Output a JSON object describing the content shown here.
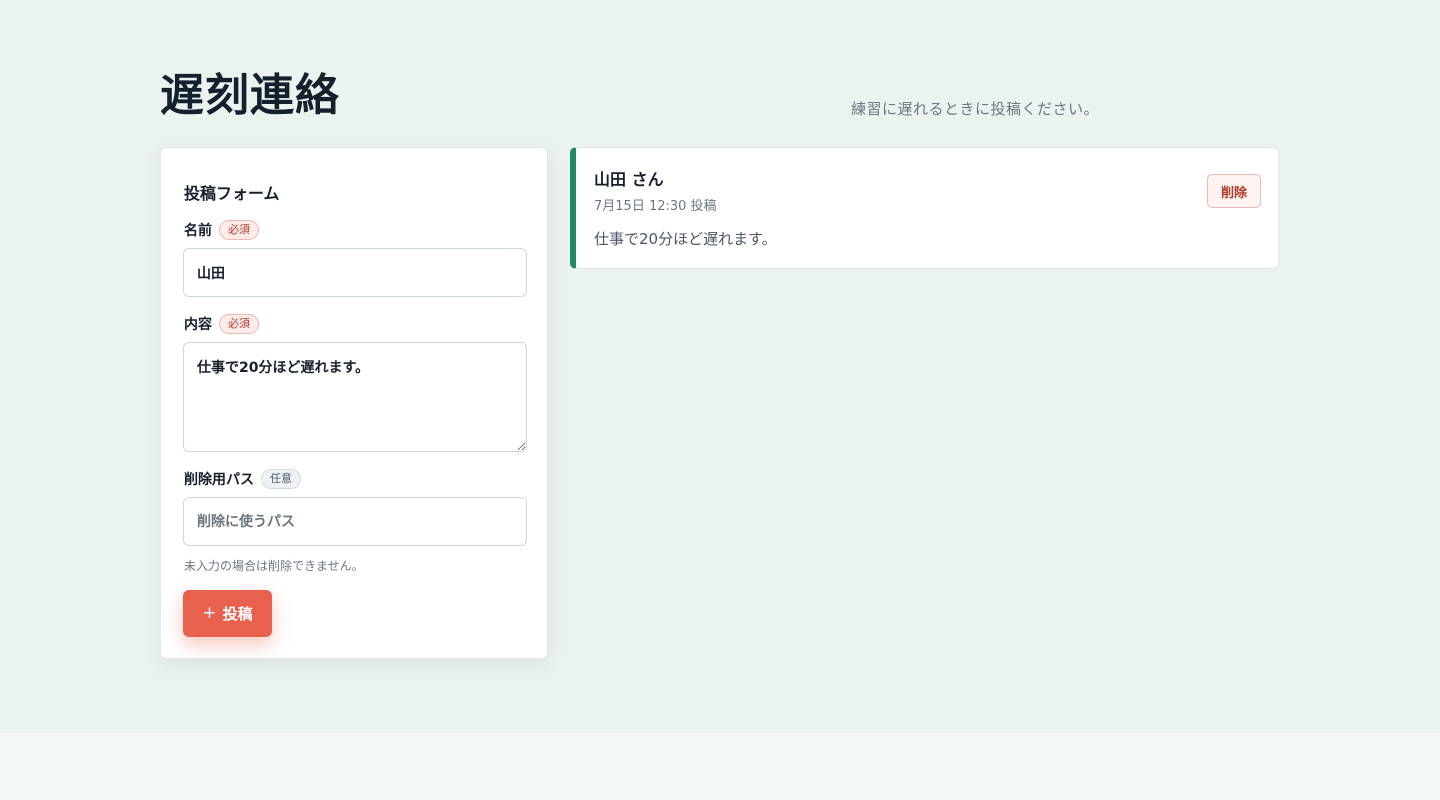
{
  "header": {
    "title": "遅刻連絡",
    "subtitle": "練習に遅れるときに投稿ください。"
  },
  "form": {
    "heading": "投稿フォーム",
    "name_label": "名前",
    "name_badge": "必須",
    "name_value": "山田",
    "content_label": "内容",
    "content_badge": "必須",
    "content_value": "仕事で20分ほど遅れます。",
    "password_label": "削除用パス",
    "password_badge": "任意",
    "password_placeholder": "削除に使うパス",
    "password_help": "未入力の場合は削除できません。",
    "submit_icon": "+",
    "submit_label": "投稿"
  },
  "posts": [
    {
      "author": "山田 さん",
      "meta": "7月15日 12:30 投稿",
      "body": "仕事で20分ほど遅れます。",
      "delete_label": "削除"
    }
  ],
  "colors": {
    "accent": "#e8604e",
    "post_border": "#1f8a65",
    "background": "#eaf3f0"
  }
}
